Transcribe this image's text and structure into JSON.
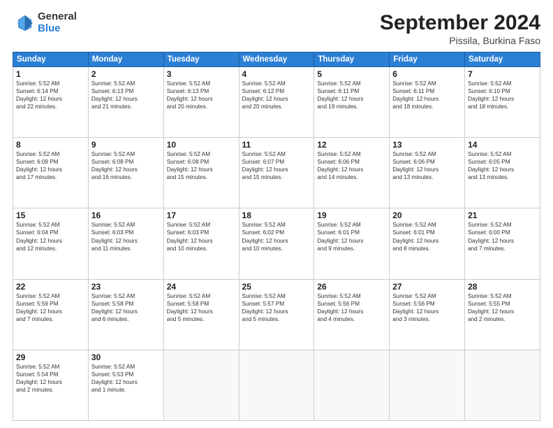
{
  "logo": {
    "general": "General",
    "blue": "Blue"
  },
  "title": {
    "month": "September 2024",
    "location": "Pissila, Burkina Faso"
  },
  "headers": [
    "Sunday",
    "Monday",
    "Tuesday",
    "Wednesday",
    "Thursday",
    "Friday",
    "Saturday"
  ],
  "weeks": [
    [
      {
        "day": "1",
        "info": "Sunrise: 5:52 AM\nSunset: 6:14 PM\nDaylight: 12 hours\nand 22 minutes."
      },
      {
        "day": "2",
        "info": "Sunrise: 5:52 AM\nSunset: 6:13 PM\nDaylight: 12 hours\nand 21 minutes."
      },
      {
        "day": "3",
        "info": "Sunrise: 5:52 AM\nSunset: 6:13 PM\nDaylight: 12 hours\nand 20 minutes."
      },
      {
        "day": "4",
        "info": "Sunrise: 5:52 AM\nSunset: 6:12 PM\nDaylight: 12 hours\nand 20 minutes."
      },
      {
        "day": "5",
        "info": "Sunrise: 5:52 AM\nSunset: 6:11 PM\nDaylight: 12 hours\nand 19 minutes."
      },
      {
        "day": "6",
        "info": "Sunrise: 5:52 AM\nSunset: 6:11 PM\nDaylight: 12 hours\nand 18 minutes."
      },
      {
        "day": "7",
        "info": "Sunrise: 5:52 AM\nSunset: 6:10 PM\nDaylight: 12 hours\nand 18 minutes."
      }
    ],
    [
      {
        "day": "8",
        "info": "Sunrise: 5:52 AM\nSunset: 6:09 PM\nDaylight: 12 hours\nand 17 minutes."
      },
      {
        "day": "9",
        "info": "Sunrise: 5:52 AM\nSunset: 6:08 PM\nDaylight: 12 hours\nand 16 minutes."
      },
      {
        "day": "10",
        "info": "Sunrise: 5:52 AM\nSunset: 6:08 PM\nDaylight: 12 hours\nand 15 minutes."
      },
      {
        "day": "11",
        "info": "Sunrise: 5:52 AM\nSunset: 6:07 PM\nDaylight: 12 hours\nand 15 minutes."
      },
      {
        "day": "12",
        "info": "Sunrise: 5:52 AM\nSunset: 6:06 PM\nDaylight: 12 hours\nand 14 minutes."
      },
      {
        "day": "13",
        "info": "Sunrise: 5:52 AM\nSunset: 6:06 PM\nDaylight: 12 hours\nand 13 minutes."
      },
      {
        "day": "14",
        "info": "Sunrise: 5:52 AM\nSunset: 6:05 PM\nDaylight: 12 hours\nand 13 minutes."
      }
    ],
    [
      {
        "day": "15",
        "info": "Sunrise: 5:52 AM\nSunset: 6:04 PM\nDaylight: 12 hours\nand 12 minutes."
      },
      {
        "day": "16",
        "info": "Sunrise: 5:52 AM\nSunset: 6:03 PM\nDaylight: 12 hours\nand 11 minutes."
      },
      {
        "day": "17",
        "info": "Sunrise: 5:52 AM\nSunset: 6:03 PM\nDaylight: 12 hours\nand 10 minutes."
      },
      {
        "day": "18",
        "info": "Sunrise: 5:52 AM\nSunset: 6:02 PM\nDaylight: 12 hours\nand 10 minutes."
      },
      {
        "day": "19",
        "info": "Sunrise: 5:52 AM\nSunset: 6:01 PM\nDaylight: 12 hours\nand 9 minutes."
      },
      {
        "day": "20",
        "info": "Sunrise: 5:52 AM\nSunset: 6:01 PM\nDaylight: 12 hours\nand 8 minutes."
      },
      {
        "day": "21",
        "info": "Sunrise: 5:52 AM\nSunset: 6:00 PM\nDaylight: 12 hours\nand 7 minutes."
      }
    ],
    [
      {
        "day": "22",
        "info": "Sunrise: 5:52 AM\nSunset: 5:59 PM\nDaylight: 12 hours\nand 7 minutes."
      },
      {
        "day": "23",
        "info": "Sunrise: 5:52 AM\nSunset: 5:58 PM\nDaylight: 12 hours\nand 6 minutes."
      },
      {
        "day": "24",
        "info": "Sunrise: 5:52 AM\nSunset: 5:58 PM\nDaylight: 12 hours\nand 5 minutes."
      },
      {
        "day": "25",
        "info": "Sunrise: 5:52 AM\nSunset: 5:57 PM\nDaylight: 12 hours\nand 5 minutes."
      },
      {
        "day": "26",
        "info": "Sunrise: 5:52 AM\nSunset: 5:56 PM\nDaylight: 12 hours\nand 4 minutes."
      },
      {
        "day": "27",
        "info": "Sunrise: 5:52 AM\nSunset: 5:56 PM\nDaylight: 12 hours\nand 3 minutes."
      },
      {
        "day": "28",
        "info": "Sunrise: 5:52 AM\nSunset: 5:55 PM\nDaylight: 12 hours\nand 2 minutes."
      }
    ],
    [
      {
        "day": "29",
        "info": "Sunrise: 5:52 AM\nSunset: 5:54 PM\nDaylight: 12 hours\nand 2 minutes."
      },
      {
        "day": "30",
        "info": "Sunrise: 5:52 AM\nSunset: 5:53 PM\nDaylight: 12 hours\nand 1 minute."
      },
      {
        "day": "",
        "info": ""
      },
      {
        "day": "",
        "info": ""
      },
      {
        "day": "",
        "info": ""
      },
      {
        "day": "",
        "info": ""
      },
      {
        "day": "",
        "info": ""
      }
    ]
  ]
}
